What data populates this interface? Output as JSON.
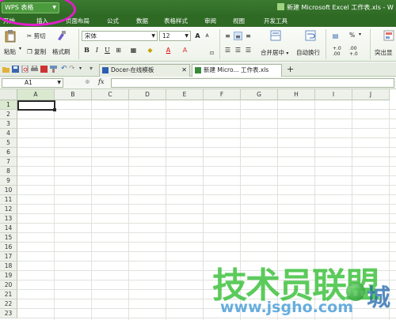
{
  "app": {
    "menu_button": "WPS 表格",
    "window_title": "新建 Microsoft Excel 工作表.xls - W"
  },
  "menu_tabs": [
    "开始",
    "插入",
    "页面布局",
    "公式",
    "数据",
    "表格样式",
    "审阅",
    "视图",
    "开发工具"
  ],
  "ribbon": {
    "paste": "粘贴",
    "cut": "剪切",
    "copy": "复制",
    "format_painter": "格式刷",
    "font_name": "宋体",
    "font_size": "12",
    "bold": "B",
    "italic": "I",
    "underline": "U",
    "merge_center": "合并居中",
    "wrap_text": "自动换行",
    "percent": "%",
    "decimal_inc": "+.0\n.00",
    "decimal_dec": ".00\n+.0",
    "highlight_dup": "突出显"
  },
  "doc_tabs": [
    {
      "label": "Docer-在线模板",
      "active": false
    },
    {
      "label": "新建 Micro... 工作表.xls",
      "active": true
    }
  ],
  "formula_bar": {
    "name_box": "A1",
    "fx": "fx",
    "content": ""
  },
  "columns": [
    "A",
    "B",
    "C",
    "D",
    "E",
    "F",
    "G",
    "H",
    "I",
    "J"
  ],
  "rows": [
    "1",
    "2",
    "3",
    "4",
    "5",
    "6",
    "7",
    "8",
    "9",
    "10",
    "11",
    "12",
    "13",
    "14",
    "15",
    "16",
    "17",
    "18",
    "19",
    "20",
    "21",
    "22",
    "23"
  ],
  "watermark": {
    "main": "技术员联盟",
    "sub": "www.jsgho.com",
    "char": "城"
  },
  "colors": {
    "title_green": "#2f6a25",
    "accent_magenta": "#e51ccd",
    "watermark_green": "#2ebd2e"
  }
}
